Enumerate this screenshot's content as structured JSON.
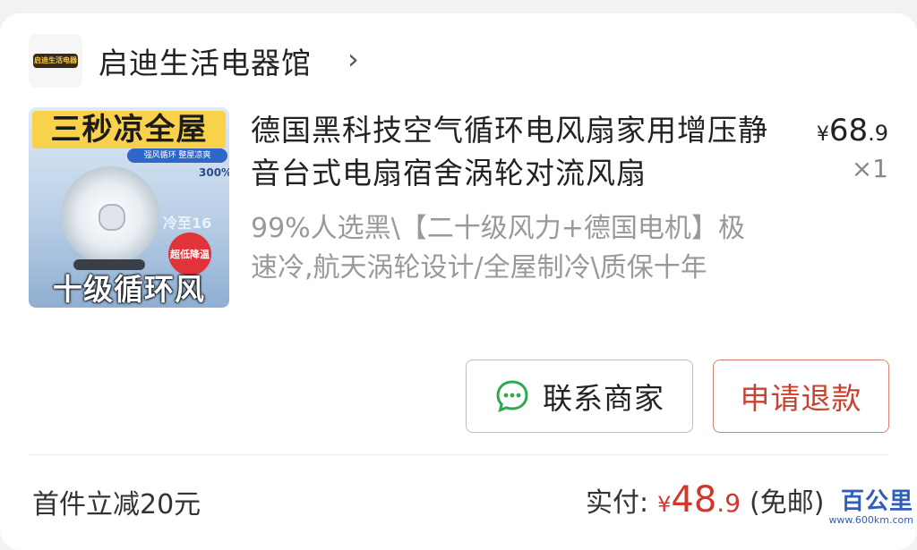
{
  "shop": {
    "name": "启迪生活电器馆",
    "arrow": "›",
    "logo_text": "启迪生活电器"
  },
  "product": {
    "image": {
      "top_text": "三秒凉全屋",
      "tags": "强风循环 整屋凉爽",
      "percent": "300%",
      "cold_text": "冷至16",
      "badge_text": "超低降温",
      "bottom_text": "十级循环风"
    },
    "title": "德国黑科技空气循环电风扇家用增压静音台式电扇宿舍涡轮对流风扇",
    "price_symbol": "¥",
    "price_int": "68",
    "price_dec": ".9",
    "quantity": "×1",
    "sku": "99%人选黑\\【二十级风力+德国电机】极速冷,航天涡轮设计/全屋制冷\\质保十年"
  },
  "actions": {
    "contact_label": "联系商家",
    "refund_label": "申请退款"
  },
  "summary": {
    "discount_text": "首件立减20元",
    "paid_label": "实付:",
    "paid_symbol": "¥",
    "paid_int": "48",
    "paid_dec": ".9",
    "paid_note": "(免邮)"
  },
  "watermark": {
    "text": "百公里",
    "url": "www.600km.com"
  },
  "colors": {
    "accent_red": "#d2362c",
    "refund_border": "#d9806f",
    "chat_green": "#2fa84f",
    "watermark_blue": "#2f5fb8"
  }
}
